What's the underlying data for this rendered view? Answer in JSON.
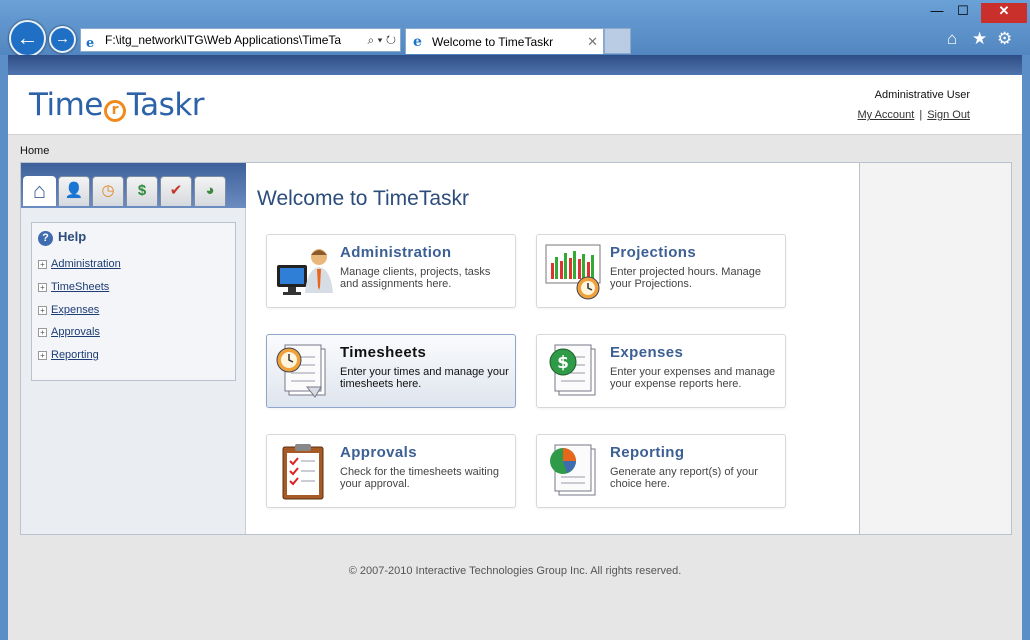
{
  "browser": {
    "address": "F:\\itg_network\\ITG\\Web Applications\\TimeTa",
    "tab_title": "Welcome to TimeTaskr"
  },
  "app": {
    "logo_text_1": "Time",
    "logo_text_2": "Taskr",
    "user_name": "Administrative User",
    "my_account": "My Account",
    "separator": "|",
    "sign_out": "Sign Out"
  },
  "breadcrumb": "Home",
  "sidebar": {
    "help_title": "Help",
    "items": [
      {
        "label": "Administration"
      },
      {
        "label": "TimeSheets"
      },
      {
        "label": "Expenses"
      },
      {
        "label": "Approvals"
      },
      {
        "label": "Reporting"
      }
    ]
  },
  "main": {
    "title": "Welcome to TimeTaskr",
    "cards": [
      {
        "title": "Administration",
        "desc": "Manage clients, projects, tasks and assignments here."
      },
      {
        "title": "Projections",
        "desc": "Enter projected hours. Manage your Projections."
      },
      {
        "title": "Timesheets",
        "desc": "Enter your times and manage your timesheets here."
      },
      {
        "title": "Expenses",
        "desc": "Enter your expenses and manage your expense reports here."
      },
      {
        "title": "Approvals",
        "desc": "Check for the timesheets waiting your approval."
      },
      {
        "title": "Reporting",
        "desc": "Generate any report(s) of your choice here."
      }
    ]
  },
  "footer": "© 2007-2010 Interactive Technologies Group Inc. All rights reserved.",
  "colors": {
    "accent": "#2c4c7c",
    "header_bar": "#2e4d86",
    "logo_orange": "#f08a1d"
  }
}
